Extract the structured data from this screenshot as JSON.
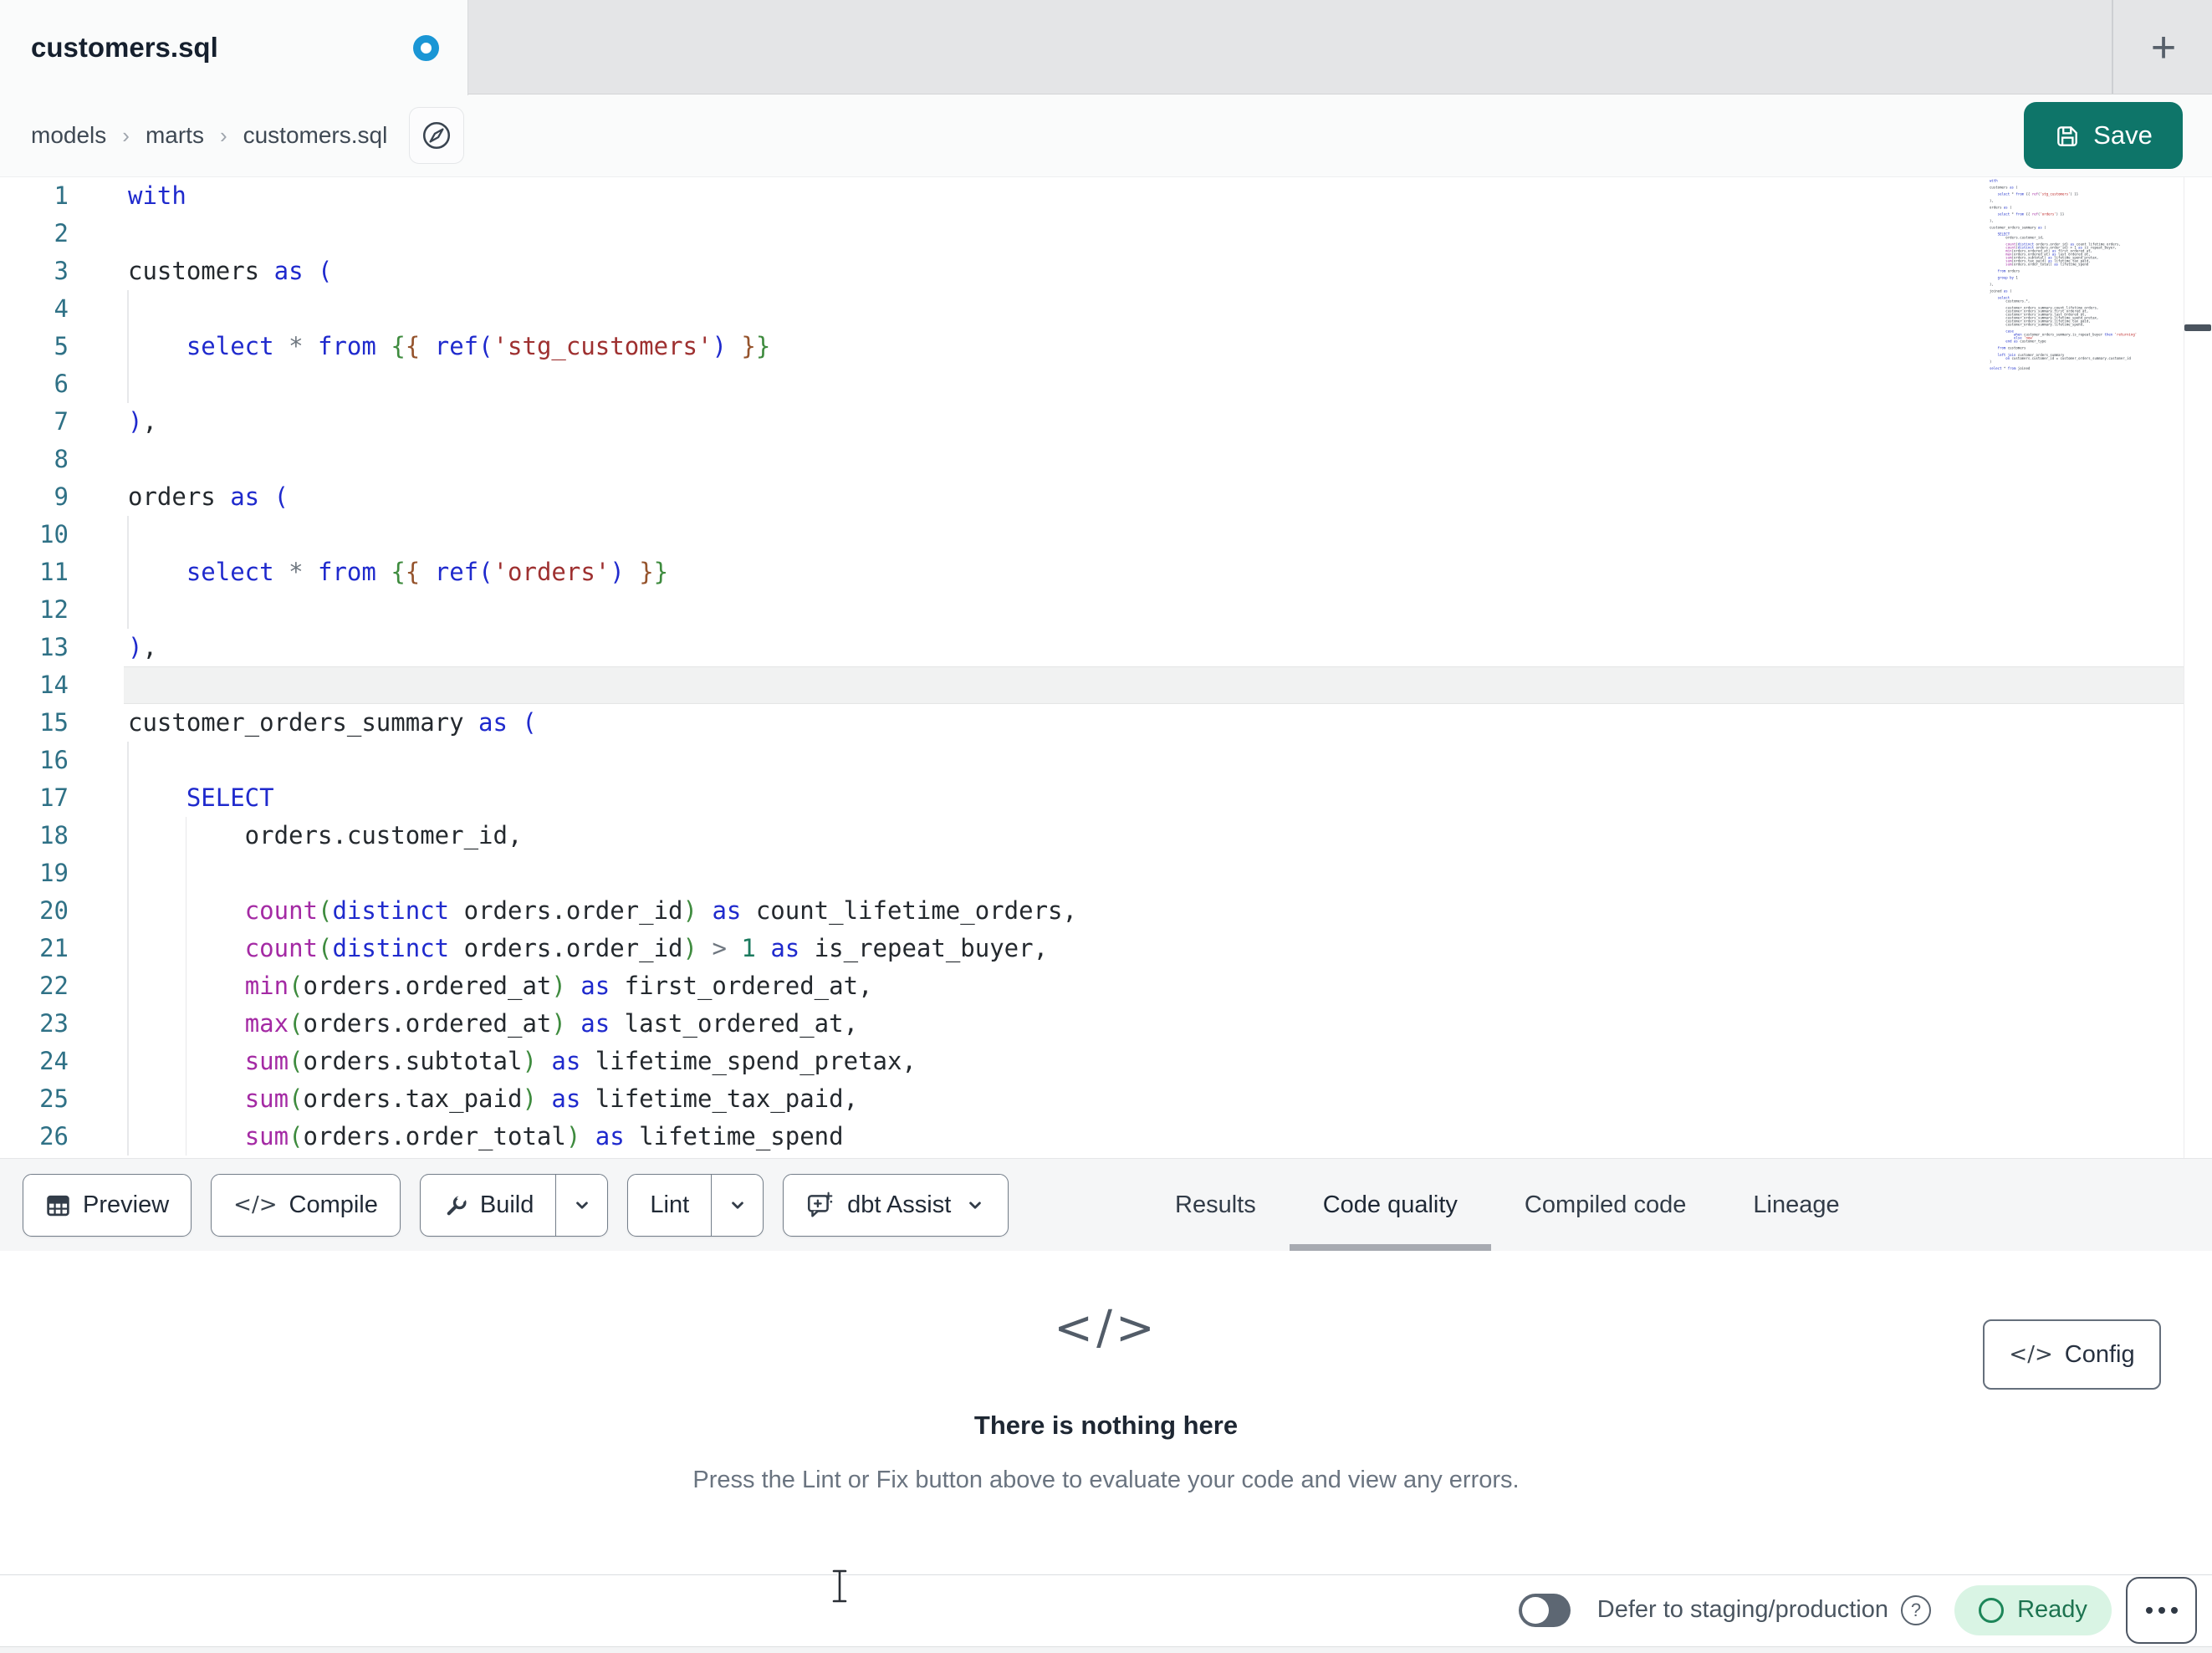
{
  "tab_bar": {
    "active_tab": {
      "title": "customers.sql",
      "modified": true
    }
  },
  "breadcrumb": {
    "items": [
      "models",
      "marts",
      "customers.sql"
    ],
    "separator": "›"
  },
  "actions": {
    "save_label": "Save"
  },
  "editor": {
    "lines": [
      {
        "n": 1,
        "segs": [
          [
            "k",
            "with"
          ]
        ]
      },
      {
        "n": 2,
        "segs": []
      },
      {
        "n": 3,
        "segs": [
          [
            "t",
            "customers "
          ],
          [
            "k",
            "as"
          ],
          [
            "t",
            " "
          ],
          [
            "k",
            "("
          ]
        ]
      },
      {
        "n": 4,
        "segs": [],
        "guides": [
          0
        ]
      },
      {
        "n": 5,
        "segs": [
          [
            "t",
            "    "
          ],
          [
            "k",
            "select"
          ],
          [
            "t",
            " "
          ],
          [
            "o",
            "*"
          ],
          [
            "t",
            " "
          ],
          [
            "k",
            "from"
          ],
          [
            "t",
            " "
          ],
          [
            "jo",
            "{"
          ],
          [
            "ji",
            "{"
          ],
          [
            "t",
            " "
          ],
          [
            "k",
            "ref("
          ],
          [
            "s",
            "'stg_customers'"
          ],
          [
            "k",
            ")"
          ],
          [
            "t",
            " "
          ],
          [
            "ji",
            "}"
          ],
          [
            "jo",
            "}"
          ]
        ],
        "guides": [
          0
        ]
      },
      {
        "n": 6,
        "segs": [],
        "guides": [
          0
        ]
      },
      {
        "n": 7,
        "segs": [
          [
            "k",
            ")"
          ],
          [
            "t",
            ","
          ]
        ]
      },
      {
        "n": 8,
        "segs": []
      },
      {
        "n": 9,
        "segs": [
          [
            "t",
            "orders "
          ],
          [
            "k",
            "as"
          ],
          [
            "t",
            " "
          ],
          [
            "k",
            "("
          ]
        ]
      },
      {
        "n": 10,
        "segs": [],
        "guides": [
          0
        ]
      },
      {
        "n": 11,
        "segs": [
          [
            "t",
            "    "
          ],
          [
            "k",
            "select"
          ],
          [
            "t",
            " "
          ],
          [
            "o",
            "*"
          ],
          [
            "t",
            " "
          ],
          [
            "k",
            "from"
          ],
          [
            "t",
            " "
          ],
          [
            "jo",
            "{"
          ],
          [
            "ji",
            "{"
          ],
          [
            "t",
            " "
          ],
          [
            "k",
            "ref("
          ],
          [
            "s",
            "'orders'"
          ],
          [
            "k",
            ")"
          ],
          [
            "t",
            " "
          ],
          [
            "ji",
            "}"
          ],
          [
            "jo",
            "}"
          ]
        ],
        "guides": [
          0
        ]
      },
      {
        "n": 12,
        "segs": [],
        "guides": [
          0
        ]
      },
      {
        "n": 13,
        "segs": [
          [
            "k",
            ")"
          ],
          [
            "t",
            ","
          ]
        ]
      },
      {
        "n": 14,
        "segs": [],
        "hl": true
      },
      {
        "n": 15,
        "segs": [
          [
            "t",
            "customer_orders_summary "
          ],
          [
            "k",
            "as"
          ],
          [
            "t",
            " "
          ],
          [
            "k",
            "("
          ]
        ]
      },
      {
        "n": 16,
        "segs": [],
        "guides": [
          0
        ]
      },
      {
        "n": 17,
        "segs": [
          [
            "t",
            "    "
          ],
          [
            "k",
            "SELECT"
          ]
        ],
        "guides": [
          0
        ]
      },
      {
        "n": 18,
        "segs": [
          [
            "t",
            "        orders.customer_id,"
          ]
        ],
        "guides": [
          0,
          4
        ]
      },
      {
        "n": 19,
        "segs": [],
        "guides": [
          0,
          4
        ]
      },
      {
        "n": 20,
        "segs": [
          [
            "t",
            "        "
          ],
          [
            "f",
            "count"
          ],
          [
            "p",
            "("
          ],
          [
            "k",
            "distinct"
          ],
          [
            "t",
            " orders.order_id"
          ],
          [
            "p",
            ")"
          ],
          [
            "t",
            " "
          ],
          [
            "k",
            "as"
          ],
          [
            "t",
            " count_lifetime_orders,"
          ]
        ],
        "guides": [
          0,
          4
        ]
      },
      {
        "n": 21,
        "segs": [
          [
            "t",
            "        "
          ],
          [
            "f",
            "count"
          ],
          [
            "p",
            "("
          ],
          [
            "k",
            "distinct"
          ],
          [
            "t",
            " orders.order_id"
          ],
          [
            "p",
            ")"
          ],
          [
            "t",
            " "
          ],
          [
            "o",
            ">"
          ],
          [
            "t",
            " "
          ],
          [
            "n",
            "1"
          ],
          [
            "t",
            " "
          ],
          [
            "k",
            "as"
          ],
          [
            "t",
            " is_repeat_buyer,"
          ]
        ],
        "guides": [
          0,
          4
        ]
      },
      {
        "n": 22,
        "segs": [
          [
            "t",
            "        "
          ],
          [
            "f",
            "min"
          ],
          [
            "p",
            "("
          ],
          [
            "t",
            "orders.ordered_at"
          ],
          [
            "p",
            ")"
          ],
          [
            "t",
            " "
          ],
          [
            "k",
            "as"
          ],
          [
            "t",
            " first_ordered_at,"
          ]
        ],
        "guides": [
          0,
          4
        ]
      },
      {
        "n": 23,
        "segs": [
          [
            "t",
            "        "
          ],
          [
            "f",
            "max"
          ],
          [
            "p",
            "("
          ],
          [
            "t",
            "orders.ordered_at"
          ],
          [
            "p",
            ")"
          ],
          [
            "t",
            " "
          ],
          [
            "k",
            "as"
          ],
          [
            "t",
            " last_ordered_at,"
          ]
        ],
        "guides": [
          0,
          4
        ]
      },
      {
        "n": 24,
        "segs": [
          [
            "t",
            "        "
          ],
          [
            "f",
            "sum"
          ],
          [
            "p",
            "("
          ],
          [
            "t",
            "orders.subtotal"
          ],
          [
            "p",
            ")"
          ],
          [
            "t",
            " "
          ],
          [
            "k",
            "as"
          ],
          [
            "t",
            " lifetime_spend_pretax,"
          ]
        ],
        "guides": [
          0,
          4
        ]
      },
      {
        "n": 25,
        "segs": [
          [
            "t",
            "        "
          ],
          [
            "f",
            "sum"
          ],
          [
            "p",
            "("
          ],
          [
            "t",
            "orders.tax_paid"
          ],
          [
            "p",
            ")"
          ],
          [
            "t",
            " "
          ],
          [
            "k",
            "as"
          ],
          [
            "t",
            " lifetime_tax_paid,"
          ]
        ],
        "guides": [
          0,
          4
        ]
      },
      {
        "n": 26,
        "segs": [
          [
            "t",
            "        "
          ],
          [
            "f",
            "sum"
          ],
          [
            "p",
            "("
          ],
          [
            "t",
            "orders.order_total"
          ],
          [
            "p",
            ")"
          ],
          [
            "t",
            " "
          ],
          [
            "k",
            "as"
          ],
          [
            "t",
            " lifetime_spend"
          ]
        ],
        "guides": [
          0,
          4
        ]
      }
    ],
    "minimap_lines": [
      "with",
      "",
      "customers as (",
      "",
      "    select * from {{ ref('stg_customers') }}",
      "",
      "),",
      "",
      "orders as (",
      "",
      "    select * from {{ ref('orders') }}",
      "",
      "),",
      "",
      "customer_orders_summary as (",
      "",
      "    SELECT",
      "        orders.customer_id,",
      "",
      "        count(distinct orders.order_id) as count_lifetime_orders,",
      "        count(distinct orders.order_id) > 1 as is_repeat_buyer,",
      "        min(orders.ordered_at) as first_ordered_at,",
      "        max(orders.ordered_at) as last_ordered_at,",
      "        sum(orders.subtotal) as lifetime_spend_pretax,",
      "        sum(orders.tax_paid) as lifetime_tax_paid,",
      "        sum(orders.order_total) as lifetime_spend",
      "",
      "    from orders",
      "",
      "    group by 1",
      "",
      "),",
      "",
      "joined as (",
      "",
      "    select",
      "        customers.*,",
      "",
      "        customer_orders_summary.count_lifetime_orders,",
      "        customer_orders_summary.first_ordered_at,",
      "        customer_orders_summary.last_ordered_at,",
      "        customer_orders_summary.lifetime_spend_pretax,",
      "        customer_orders_summary.lifetime_tax_paid,",
      "        customer_orders_summary.lifetime_spend,",
      "",
      "        case",
      "            when customer_orders_summary.is_repeat_buyer then 'returning'",
      "            else 'new'",
      "        end as customer_type",
      "",
      "    from customers",
      "",
      "    left join customer_orders_summary",
      "        on customers.customer_id = customer_orders_summary.customer_id",
      ")",
      "",
      "select * from joined"
    ]
  },
  "toolbar": {
    "preview": "Preview",
    "compile": "Compile",
    "build": "Build",
    "lint": "Lint",
    "dbt_assist": "dbt Assist"
  },
  "panel_tabs": [
    {
      "label": "Results",
      "active": false
    },
    {
      "label": "Code quality",
      "active": true
    },
    {
      "label": "Compiled code",
      "active": false
    },
    {
      "label": "Lineage",
      "active": false
    }
  ],
  "empty_state": {
    "title": "There is nothing here",
    "subtitle": "Press the Lint or Fix button above to evaluate your code and view any errors."
  },
  "config": {
    "label": "Config"
  },
  "status_bar": {
    "defer_label": "Defer to staging/production",
    "defer_enabled": false,
    "ready_label": "Ready"
  },
  "colors": {
    "accent_teal": "#0e7569",
    "modified_dot_blue": "#1a96d5",
    "ready_badge_bg": "#d9f4e4",
    "ready_badge_text": "#1d7350",
    "active_tab_underline": "#a7aab1",
    "syntax": {
      "keyword": "#1f2acd",
      "function": "#a42aa4",
      "paren": "#3e8b3e",
      "string": "#9e3030",
      "jinja_outer": "#3e8b3e",
      "jinja_inner": "#95532c",
      "number": "#1b7a5e",
      "operator": "#6f7780",
      "text": "#24292e",
      "line_number": "#2f7186"
    }
  }
}
